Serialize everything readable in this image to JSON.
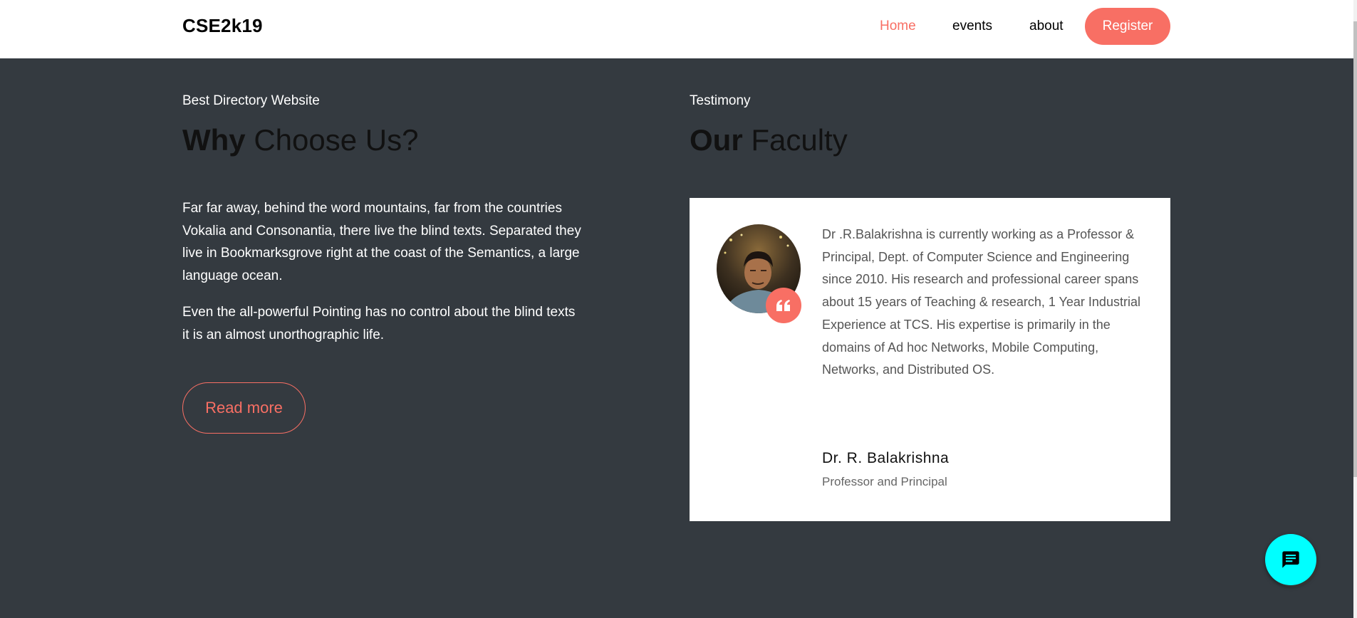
{
  "header": {
    "brand": "CSE2k19",
    "nav": [
      "Home",
      "events",
      "about"
    ],
    "register_label": "Register",
    "accent_color": "#f86f64"
  },
  "why": {
    "subheading": "Best Directory Website",
    "heading_bold": "Why",
    "heading_rest": " Choose Us?",
    "paragraph1": "Far far away, behind the word mountains, far from the countries Vokalia and Consonantia, there live the blind texts. Separated they live in Bookmarksgrove right at the coast of the Semantics, a large language ocean.",
    "paragraph2": "Even the all-powerful Pointing has no control about the blind texts it is an almost unorthographic life.",
    "read_more": "Read more"
  },
  "testimony": {
    "subheading": "Testimony",
    "heading_bold": "Our",
    "heading_rest": " Faculty",
    "quote": "Dr .R.Balakrishna is currently working as a Professor & Principal, Dept. of Computer Science and Engineering since 2010. His research and professional career spans about 15 years of Teaching & research, 1 Year Industrial Experience at TCS. His expertise is primarily in the domains of Ad hoc Networks, Mobile Computing, Networks, and Distributed OS.",
    "name": "Dr. R. Balakrishna",
    "role": "Professor and Principal",
    "quote_icon": "quote-left-icon"
  },
  "chat": {
    "icon": "chat-icon",
    "color": "#00ffff"
  }
}
